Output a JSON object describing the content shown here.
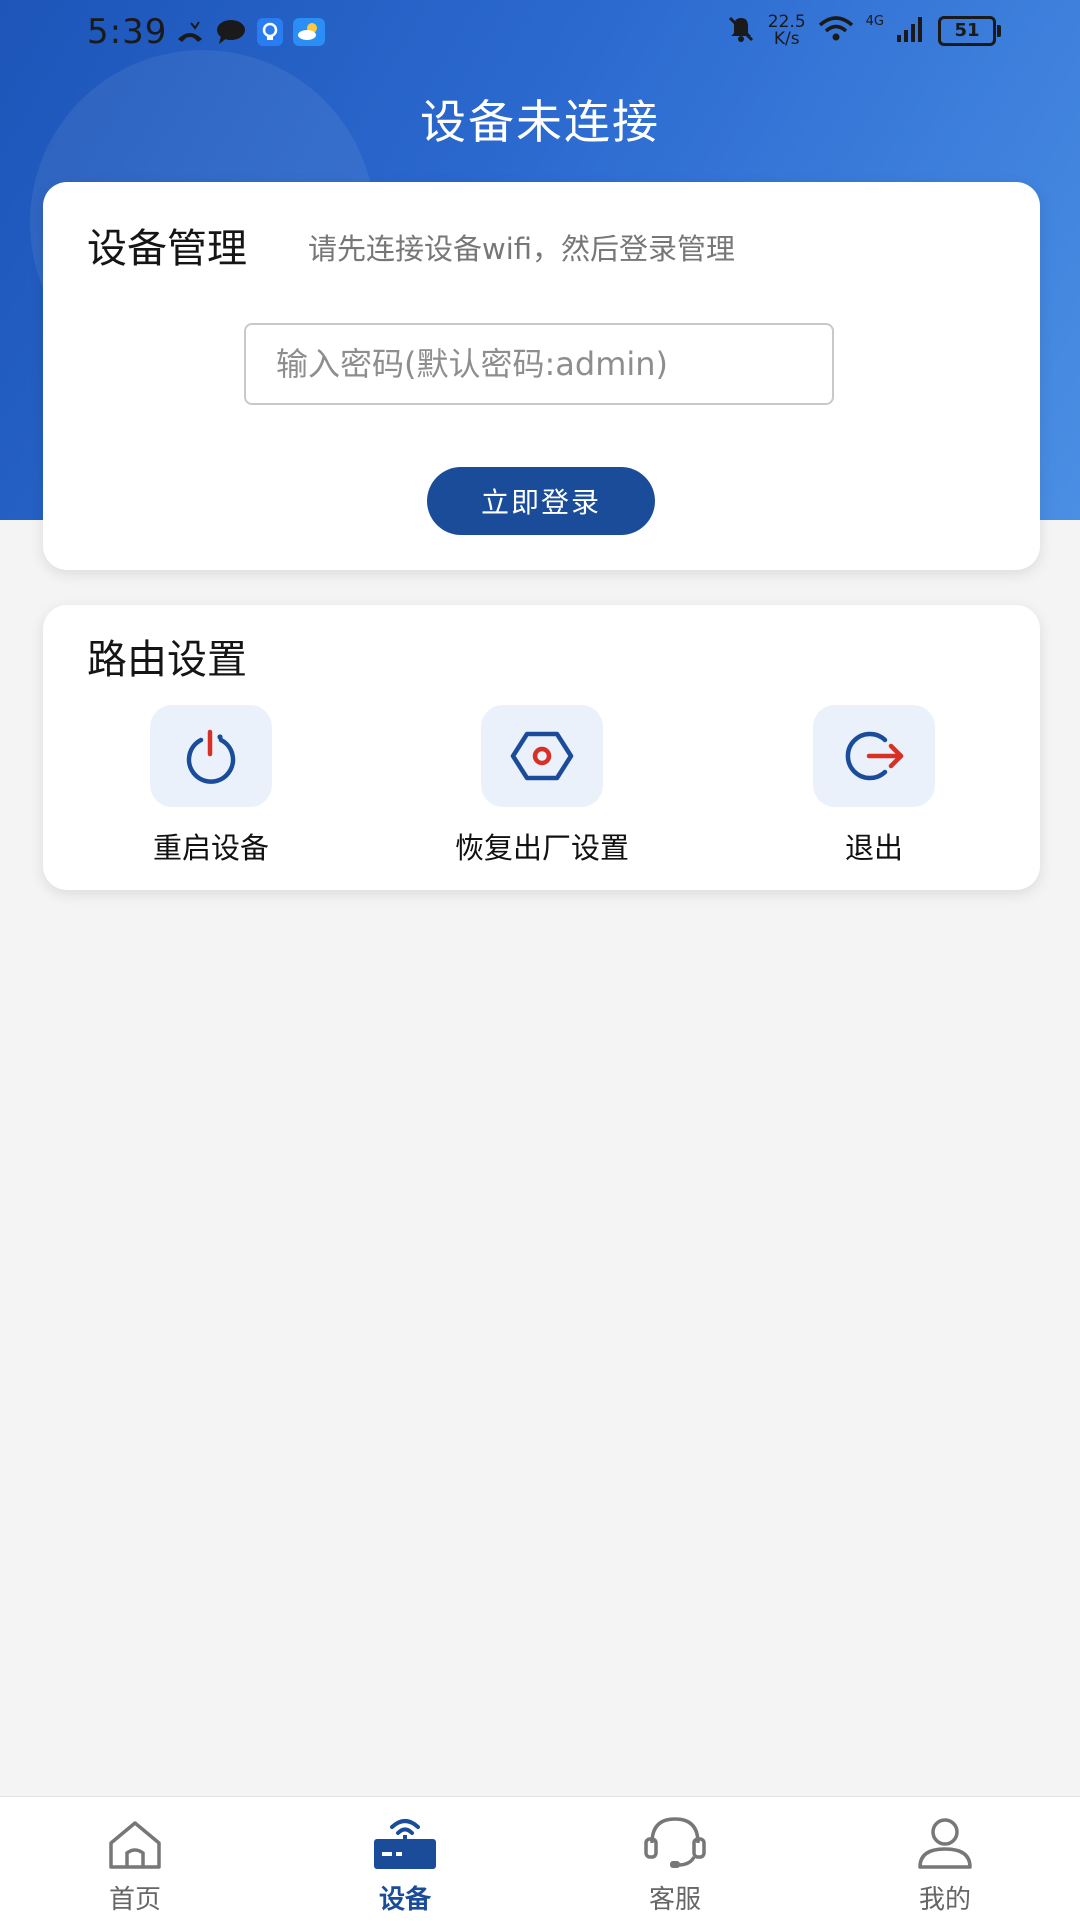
{
  "status_bar": {
    "time": "5:39",
    "net_speed_value": "22.5",
    "net_speed_unit": "K/s",
    "network_type": "4G",
    "battery": "51"
  },
  "header": {
    "title": "设备未连接"
  },
  "device_manage": {
    "title": "设备管理",
    "hint": "请先连接设备wifi，然后登录管理",
    "password_placeholder": "输入密码(默认密码:admin)",
    "password_value": "",
    "login_label": "立即登录"
  },
  "router_settings": {
    "title": "路由设置",
    "actions": [
      {
        "label": "重启设备",
        "icon": "power-icon"
      },
      {
        "label": "恢复出厂设置",
        "icon": "hex-nut-icon"
      },
      {
        "label": "退出",
        "icon": "logout-icon"
      }
    ]
  },
  "bottom_nav": {
    "items": [
      {
        "label": "首页",
        "icon": "home-icon"
      },
      {
        "label": "设备",
        "icon": "router-icon",
        "active": true
      },
      {
        "label": "客服",
        "icon": "headset-icon"
      },
      {
        "label": "我的",
        "icon": "user-icon"
      }
    ]
  },
  "colors": {
    "primary": "#1b4c9a",
    "header_gradient_start": "#1d55b8",
    "header_gradient_end": "#4a8fe4",
    "icon_bg": "#eaf1fb",
    "accent_red": "#d93025"
  }
}
